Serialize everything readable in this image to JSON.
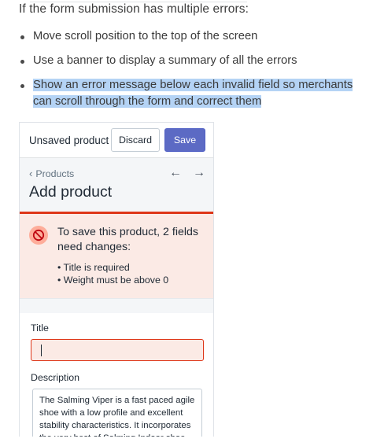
{
  "intro": "If the form submission has multiple errors:",
  "bullets": [
    "Move scroll position to the top of the screen",
    "Use a banner to display a summary of all the errors",
    "Show an error message below each invalid field so merchants can scroll through the form and correct them"
  ],
  "panel": {
    "header": {
      "title": "Unsaved product",
      "discard_label": "Discard",
      "save_label": "Save"
    },
    "breadcrumb": "Products",
    "page_title": "Add product",
    "error_banner": {
      "title": "To save this product, 2 fields need changes:",
      "items": [
        "• Title is required",
        "• Weight must be above 0"
      ]
    },
    "form": {
      "title_label": "Title",
      "title_value": "",
      "description_label": "Description",
      "description_value": "The Salming Viper is a fast paced agile shoe with a low profile and excellent stability characteristics. It incorporates the very best of Salming Indoor shoe"
    }
  },
  "colors": {
    "highlight": "#b4d3f5",
    "primary": "#5c6ac4",
    "critical": "#de3618",
    "critical_bg": "#fbeae5"
  }
}
